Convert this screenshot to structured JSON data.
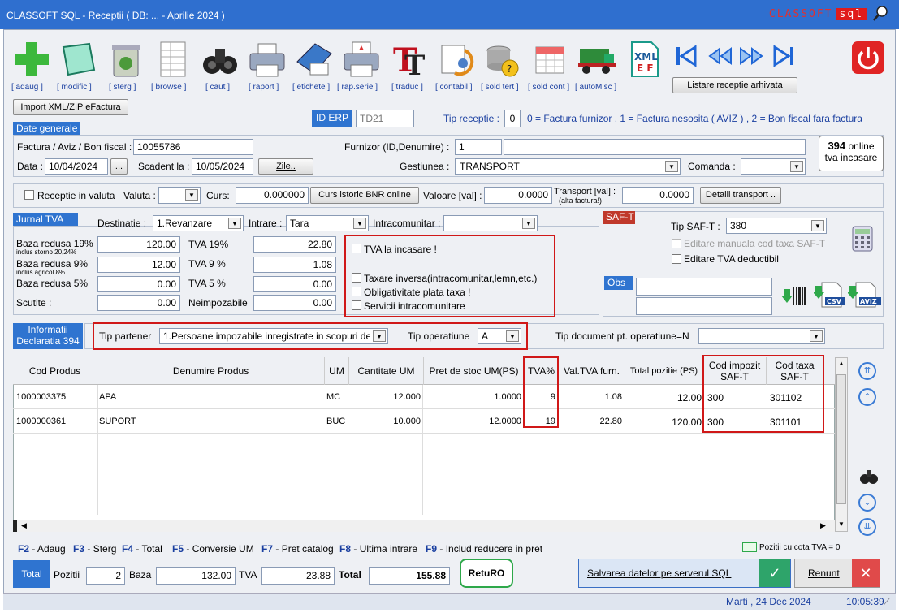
{
  "title": "CLASSOFT SQL - Receptii ( DB: ... - Aprilie 2024 )",
  "logo": {
    "text": "CLASSOFT",
    "sql": "sql"
  },
  "toolbar": [
    "[ adaug ]",
    "[ modific ]",
    "[ sterg ]",
    "[ browse ]",
    "[ caut ]",
    "[ raport ]",
    "[ etichete ]",
    "[ rap.serie ]",
    "[ traduc ]",
    "[ contabil ]",
    "[ sold tert ]",
    "[ sold cont ]",
    "[ autoMisc ]"
  ],
  "archive_button": "Listare receptie arhivata",
  "import_button": "Import XML/ZIP eFactura",
  "id_erp": {
    "label": "ID ERP",
    "value": "TD21"
  },
  "tip_receptie": {
    "label": "Tip receptie :",
    "value": "0",
    "help": "0 = Factura  furnizor , 1 = Factura nesosita ( AVIZ ) , 2  = Bon fiscal fara factura"
  },
  "general": {
    "section": "Date generale",
    "factura_label": "Factura / Aviz / Bon fiscal :",
    "factura": "10055786",
    "data_label": "Data :",
    "data": "10/04/2024",
    "data_btn": "...",
    "scadent_label": "Scadent la :",
    "scadent": "10/05/2024",
    "zile_btn": "Zile..",
    "furnizor_label": "Furnizor (ID,Denumire) :",
    "furnizor_id": "1",
    "furnizor_name": "",
    "gestiune_label": "Gestiunea :",
    "gestiune": "TRANSPORT",
    "comanda_label": "Comanda :",
    "comanda": "",
    "online_count": "394",
    "online_word": "online",
    "online_sub": "tva incasare"
  },
  "valuta": {
    "checkbox": "Receptie in valuta",
    "valuta_label": "Valuta :",
    "valuta": "",
    "curs_label": "Curs:",
    "curs": "0.000000",
    "curs_btn": "Curs istoric BNR online",
    "valoare_label": "Valoare [val] :",
    "valoare": "0.0000",
    "transport_label": "Transport [val] :",
    "transport_sub": "(alta factura!)",
    "transport": "0.0000",
    "detalii_btn": "Detalii transport .."
  },
  "jurnal": {
    "section": "Jurnal TVA",
    "destinatie_label": "Destinatie :",
    "destinatie": "1.Revanzare",
    "intrare_label": "Intrare :",
    "intrare": "Tara",
    "intra_label": "Intracomunitar :",
    "intra": "",
    "rows": [
      {
        "label": "Baza redusa 19%",
        "sub": "inclus storno 20,24%",
        "baza": "120.00",
        "tva_label": "TVA 19%",
        "tva": "22.80"
      },
      {
        "label": "Baza redusa 9%",
        "sub": "inclus agricol 8%",
        "baza": "12.00",
        "tva_label": "TVA 9 %",
        "tva": "1.08"
      },
      {
        "label": "Baza redusa 5%",
        "sub": "",
        "baza": "0.00",
        "tva_label": "TVA 5 %",
        "tva": "0.00"
      },
      {
        "label": "Scutite :",
        "sub": "",
        "baza": "0.00",
        "tva_label": "Neimpozabile",
        "tva": "0.00"
      }
    ],
    "checks": [
      "TVA la incasare !",
      "Taxare inversa(intracomunitar,lemn,etc.)",
      "Obligativitate plata taxa !",
      "Servicii intracomunitare"
    ]
  },
  "saft": {
    "section": "SAF-T",
    "tip_label": "Tip SAF-T :",
    "tip": "380",
    "chk1": "Editare manuala cod taxa SAF-T",
    "chk2": "Editare TVA deductibil",
    "obs": "Obs",
    "csv": "CSV",
    "aviz": "AVIZ"
  },
  "decl": {
    "section": "Informatii Declaratia 394",
    "tip_partener_label": "Tip partener",
    "tip_partener": "1.Persoane impozabile inregistrate in scopuri de TVA",
    "tip_op_label": "Tip operatiune",
    "tip_op": "A",
    "tip_doc_label": "Tip document pt. operatiune=N",
    "tip_doc": ""
  },
  "grid": {
    "headers": [
      "Cod Produs",
      "Denumire Produs",
      "UM",
      "Cantitate UM",
      "Pret de stoc UM(PS)",
      "TVA%",
      "Val.TVA furn.",
      "Total pozitie (PS)",
      "Cod impozit SAF-T",
      "Cod taxa SAF-T"
    ],
    "rows": [
      [
        "1000003375",
        "APA",
        "MC",
        "12.000",
        "1.0000",
        "9",
        "1.08",
        "12.00",
        "300",
        "301102"
      ],
      [
        "1000000361",
        "SUPORT",
        "BUC",
        "10.000",
        "12.0000",
        "19",
        "22.80",
        "120.00",
        "300",
        "301101"
      ]
    ]
  },
  "fkeys": [
    [
      "F2",
      "- Adaug"
    ],
    [
      "F3",
      "- Sterg"
    ],
    [
      "F4",
      "- Total"
    ],
    [
      "F5",
      "- Conversie UM"
    ],
    [
      "F7",
      "- Pret catalog"
    ],
    [
      "F8",
      "- Ultima intrare"
    ],
    [
      "F9",
      "- Includ reducere in pret"
    ]
  ],
  "legend": "Pozitii cu cota TVA = 0",
  "totals": {
    "total_btn": "Total",
    "pozitii_label": "Pozitii",
    "pozitii": "2",
    "baza_label": "Baza",
    "baza": "132.00",
    "tva_label": "TVA",
    "tva": "23.88",
    "total_label": "Total",
    "total": "155.88",
    "returo": "RetuRO"
  },
  "save_btn": "Salvarea datelor pe serverul SQL",
  "cancel_btn": "Renunt",
  "status": {
    "date": "Marti ,  24 Dec 2024",
    "time": "10:05:39"
  }
}
